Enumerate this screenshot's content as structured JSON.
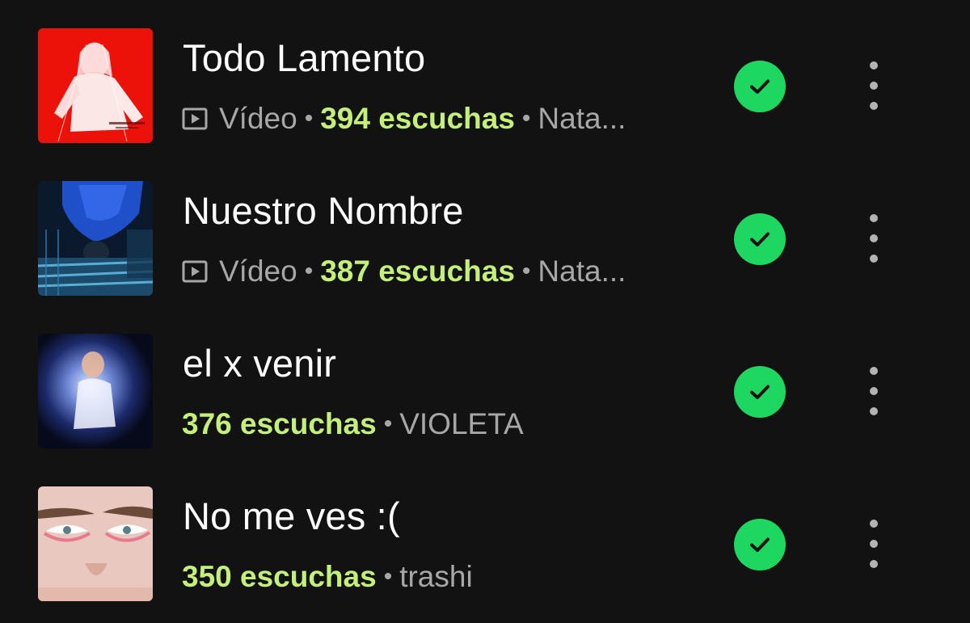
{
  "tracks": [
    {
      "title": "Todo Lamento",
      "is_video": true,
      "type_label": "Vídeo",
      "plays": "394 escuchas",
      "artist": "Nata...",
      "downloaded": true
    },
    {
      "title": "Nuestro Nombre",
      "is_video": true,
      "type_label": "Vídeo",
      "plays": "387 escuchas",
      "artist": "Nata...",
      "downloaded": true
    },
    {
      "title": "el x venir",
      "is_video": false,
      "plays": "376 escuchas",
      "artist": "VIOLETA",
      "downloaded": true
    },
    {
      "title": "No me ves :(",
      "is_video": false,
      "plays": "350 escuchas",
      "artist": "trashi",
      "downloaded": true
    }
  ],
  "colors": {
    "background": "#121212",
    "title": "#ffffff",
    "meta": "#a7a7a7",
    "plays_accent": "#c4f07a",
    "downloaded_badge": "#1ed760"
  },
  "icons": {
    "downloaded": "checkmark-circle-icon",
    "more": "more-vertical-icon",
    "video": "video-play-icon"
  }
}
